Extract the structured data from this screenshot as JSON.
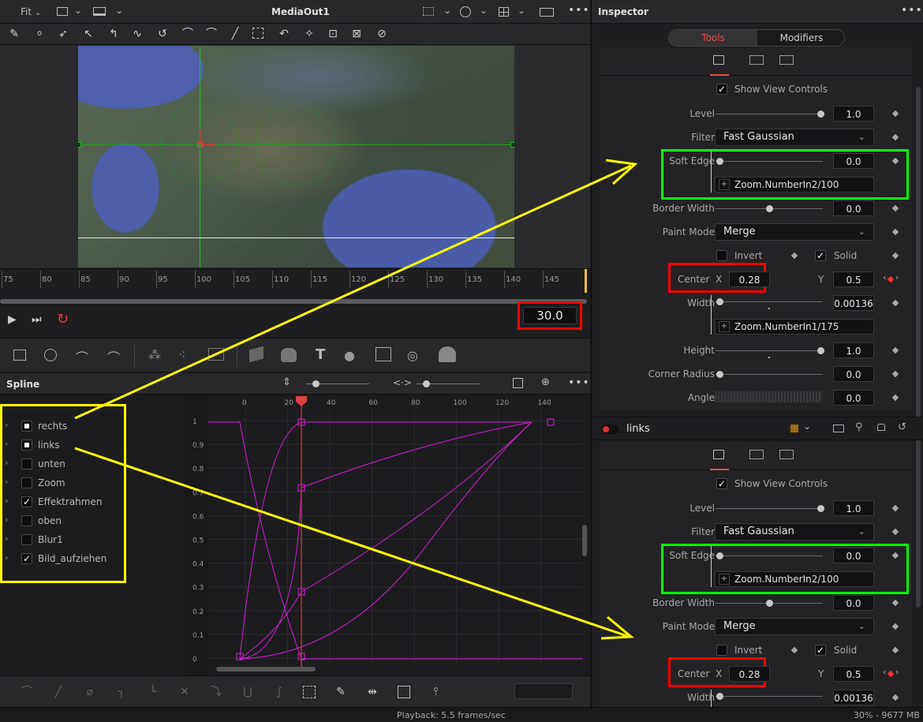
{
  "viewer": {
    "fit_label": "Fit",
    "title": "MediaOut1",
    "ruler_ticks": [
      "75",
      "80",
      "85",
      "90",
      "95",
      "100",
      "105",
      "110",
      "115",
      "120",
      "125",
      "130",
      "135",
      "140",
      "145"
    ],
    "timecode": "30.0"
  },
  "spline": {
    "title": "Spline",
    "items": [
      {
        "label": "rechts",
        "state": "dot"
      },
      {
        "label": "links",
        "state": "dot"
      },
      {
        "label": "unten",
        "state": "off"
      },
      {
        "label": "Zoom",
        "state": "off"
      },
      {
        "label": "Effektrahmen",
        "state": "check"
      },
      {
        "label": "oben",
        "state": "off"
      },
      {
        "label": "Blur1",
        "state": "off"
      },
      {
        "label": "Bild_aufziehen",
        "state": "check"
      }
    ],
    "x_ticks": [
      "0",
      "20",
      "40",
      "60",
      "80",
      "100",
      "120",
      "140"
    ],
    "y_ticks": [
      "1",
      "0.9",
      "0.8",
      "0.7",
      "0.6",
      "0.5",
      "0.4",
      "0.3",
      "0.2",
      "0.1",
      "0"
    ]
  },
  "inspector": {
    "title": "Inspector",
    "tab_tools": "Tools",
    "tab_modifiers": "Modifiers",
    "node2_name": "links",
    "blocks": [
      {
        "show_view_controls": "Show View Controls",
        "level_label": "Level",
        "level_value": "1.0",
        "filter_label": "Filter",
        "filter_value": "Fast Gaussian",
        "soft_edge_label": "Soft Edge",
        "soft_edge_value": "0.0",
        "soft_edge_expr": "Zoom.NumberIn2/100",
        "border_width_label": "Border Width",
        "border_width_value": "0.0",
        "paint_mode_label": "Paint Mode",
        "paint_mode_value": "Merge",
        "invert_label": "Invert",
        "solid_label": "Solid",
        "center_label": "Center",
        "x_label": "X",
        "center_x": "0.28",
        "y_label": "Y",
        "center_y": "0.5",
        "width_label": "Width",
        "width_value": "0.00136",
        "width_expr": "Zoom.NumberIn1/175",
        "height_label": "Height",
        "height_value": "1.0",
        "corner_radius_label": "Corner Radius",
        "corner_radius_value": "0.0",
        "angle_label": "Angle",
        "angle_value": "0.0"
      },
      {
        "show_view_controls": "Show View Controls",
        "level_label": "Level",
        "level_value": "1.0",
        "filter_label": "Filter",
        "filter_value": "Fast Gaussian",
        "soft_edge_label": "Soft Edge",
        "soft_edge_value": "0.0",
        "soft_edge_expr": "Zoom.NumberIn2/100",
        "border_width_label": "Border Width",
        "border_width_value": "0.0",
        "paint_mode_label": "Paint Mode",
        "paint_mode_value": "Merge",
        "invert_label": "Invert",
        "solid_label": "Solid",
        "center_label": "Center",
        "x_label": "X",
        "center_x": "0.28",
        "y_label": "Y",
        "center_y": "0.5",
        "width_label": "Width",
        "width_value": "0.00136"
      }
    ]
  },
  "status": {
    "playback": "Playback: 5.5 frames/sec",
    "memory": "30% - 9677 MB"
  },
  "colors": {
    "annotation_yellow": "#ffff00",
    "annotation_green": "#00ff00",
    "annotation_red": "#ff0000",
    "spline_magenta": "#d020d0",
    "playhead_red": "#e04040"
  }
}
